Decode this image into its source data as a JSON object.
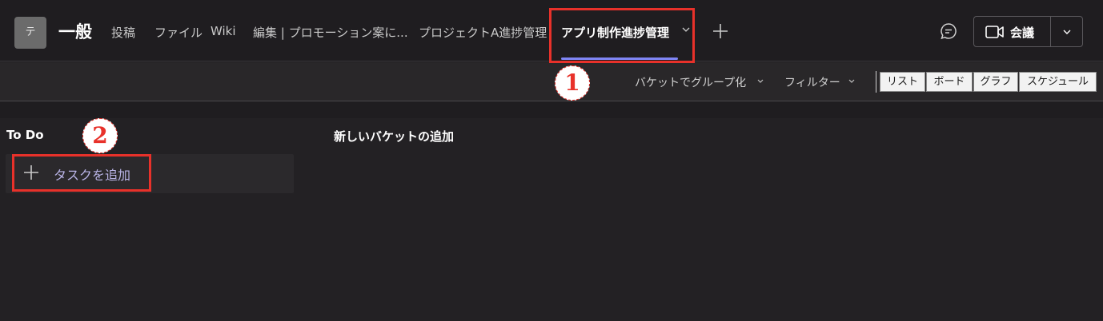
{
  "header": {
    "team_initial": "テ",
    "channel_name": "一般",
    "tabs": [
      {
        "label": "投稿"
      },
      {
        "label": "ファイル"
      },
      {
        "label": "Wiki"
      },
      {
        "label": "編集 | プロモーション案に..."
      },
      {
        "label": "プロジェクトA進捗管理"
      },
      {
        "label": "アプリ制作進捗管理",
        "active": true
      }
    ],
    "meet_label": "会議"
  },
  "toolbar": {
    "group_by_label": "バケットでグループ化",
    "filter_label": "フィルター",
    "views": [
      "リスト",
      "ボード",
      "グラフ",
      "スケジュール"
    ]
  },
  "board": {
    "bucket_title": "To Do",
    "add_task_label": "タスクを追加",
    "new_bucket_label": "新しいバケットの追加"
  },
  "annotations": {
    "one": "1",
    "two": "2",
    "color": "#e8312a"
  },
  "colors": {
    "accent": "#7f85f5",
    "background": "#1f1d20"
  }
}
